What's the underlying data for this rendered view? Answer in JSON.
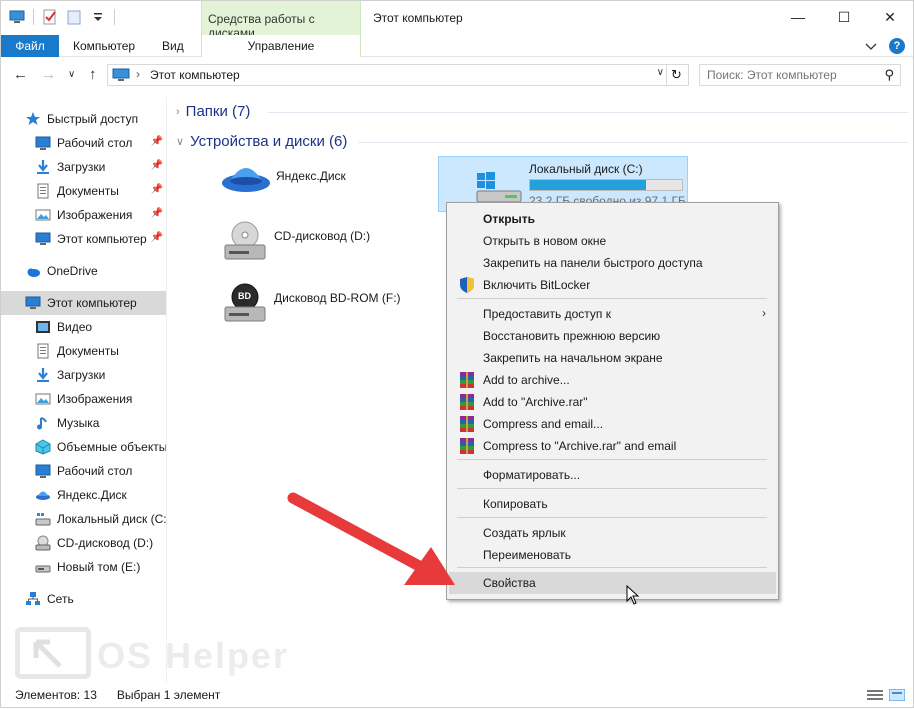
{
  "window": {
    "title": "Этот компьютер",
    "context_tab_group": "Средства работы с дисками",
    "controls": {
      "minimize": "—",
      "maximize": "☐",
      "close": "✕"
    }
  },
  "ribbon": {
    "tabs": [
      "Файл",
      "Компьютер",
      "Вид",
      "Управление"
    ]
  },
  "address": {
    "path": "Этот компьютер",
    "search_placeholder": "Поиск: Этот компьютер"
  },
  "sidebar": {
    "items": [
      {
        "label": "Быстрый доступ",
        "icon": "star-icon",
        "pinned": false
      },
      {
        "label": "Рабочий стол",
        "icon": "desktop-icon",
        "pinned": true
      },
      {
        "label": "Загрузки",
        "icon": "download-icon",
        "pinned": true
      },
      {
        "label": "Документы",
        "icon": "documents-icon",
        "pinned": true
      },
      {
        "label": "Изображения",
        "icon": "pictures-icon",
        "pinned": true
      },
      {
        "label": "Этот компьютер",
        "icon": "computer-icon",
        "pinned": true
      },
      {
        "label": "OneDrive",
        "icon": "cloud-icon",
        "pinned": false
      },
      {
        "label": "Этот компьютер",
        "icon": "computer-icon",
        "pinned": false,
        "active": true
      },
      {
        "label": "Видео",
        "icon": "video-icon",
        "pinned": false
      },
      {
        "label": "Документы",
        "icon": "documents-icon",
        "pinned": false
      },
      {
        "label": "Загрузки",
        "icon": "download-icon",
        "pinned": false
      },
      {
        "label": "Изображения",
        "icon": "pictures-icon",
        "pinned": false
      },
      {
        "label": "Музыка",
        "icon": "music-icon",
        "pinned": false
      },
      {
        "label": "Объемные объекты",
        "icon": "3d-objects-icon",
        "pinned": false
      },
      {
        "label": "Рабочий стол",
        "icon": "desktop-icon",
        "pinned": false
      },
      {
        "label": "Яндекс.Диск",
        "icon": "yandex-disk-icon",
        "pinned": false
      },
      {
        "label": "Локальный диск (C:",
        "icon": "hard-drive-icon",
        "pinned": false
      },
      {
        "label": "CD-дисковод (D:)",
        "icon": "cd-drive-icon",
        "pinned": false
      },
      {
        "label": "Новый том (E:)",
        "icon": "drive-icon",
        "pinned": false
      },
      {
        "label": "Сеть",
        "icon": "network-icon",
        "pinned": false
      }
    ]
  },
  "main": {
    "groups": [
      {
        "title": "Папки (7)",
        "expanded": false
      },
      {
        "title": "Устройства и диски (6)",
        "expanded": true
      }
    ],
    "drives": [
      {
        "name": "Яндекс.Диск",
        "icon": "yandex-disk-icon"
      },
      {
        "name": "CD-дисковод (D:)",
        "icon": "cd-drive-icon"
      },
      {
        "name": "Дисковод BD-ROM (F:)",
        "icon": "bd-drive-icon",
        "badge": "BD"
      },
      {
        "name": "Локальный диск (C:)",
        "icon": "windows-drive-icon",
        "free": "23.2 ГБ свободно из 97.1 ГБ",
        "used_fraction": 0.76,
        "selected": true
      }
    ]
  },
  "context_menu": {
    "items": [
      {
        "label": "Открыть",
        "bold": true
      },
      {
        "label": "Открыть в новом окне"
      },
      {
        "label": "Закрепить на панели быстрого доступа"
      },
      {
        "label": "Включить BitLocker",
        "icon": "shield-icon"
      },
      {
        "label": "Предоставить доступ к",
        "submenu": true
      },
      {
        "label": "Восстановить прежнюю версию"
      },
      {
        "label": "Закрепить на начальном экране"
      },
      {
        "label": "Add to archive...",
        "icon": "winrar-icon"
      },
      {
        "label": "Add to \"Archive.rar\"",
        "icon": "winrar-icon"
      },
      {
        "label": "Compress and email...",
        "icon": "winrar-icon"
      },
      {
        "label": "Compress to \"Archive.rar\" and email",
        "icon": "winrar-icon"
      },
      {
        "label": "Форматировать..."
      },
      {
        "label": "Копировать"
      },
      {
        "label": "Создать ярлык"
      },
      {
        "label": "Переименовать"
      },
      {
        "label": "Свойства",
        "hover": true
      }
    ]
  },
  "status": {
    "count": "Элементов: 13",
    "selected": "Выбран 1 элемент"
  },
  "watermark": {
    "text": "OS Helper"
  },
  "colors": {
    "accent": "#1979ca",
    "selection": "#cce8ff",
    "progress": "#26a0da",
    "arrow": "#e8393b"
  }
}
